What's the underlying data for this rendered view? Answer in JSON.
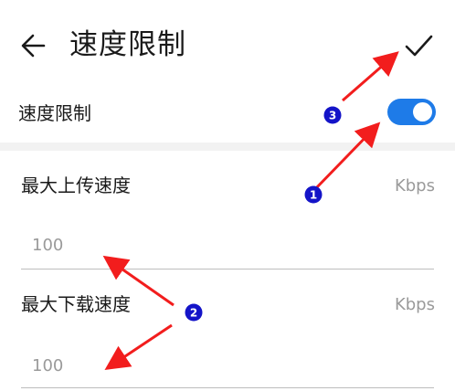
{
  "header": {
    "back_icon": "arrow-left-icon",
    "title": "速度限制",
    "confirm_icon": "checkmark-icon"
  },
  "toggle": {
    "label": "速度限制",
    "state": "on",
    "color": "#1e7be8"
  },
  "upload": {
    "label": "最大上传速度",
    "unit": "Kbps",
    "placeholder": "100"
  },
  "download": {
    "label": "最大下载速度",
    "unit": "Kbps",
    "placeholder": "100"
  },
  "annotations": {
    "marker_1": "1",
    "marker_2": "2",
    "marker_3": "3",
    "arrow_color": "#f21d1d",
    "marker_color": "#1414c8"
  }
}
